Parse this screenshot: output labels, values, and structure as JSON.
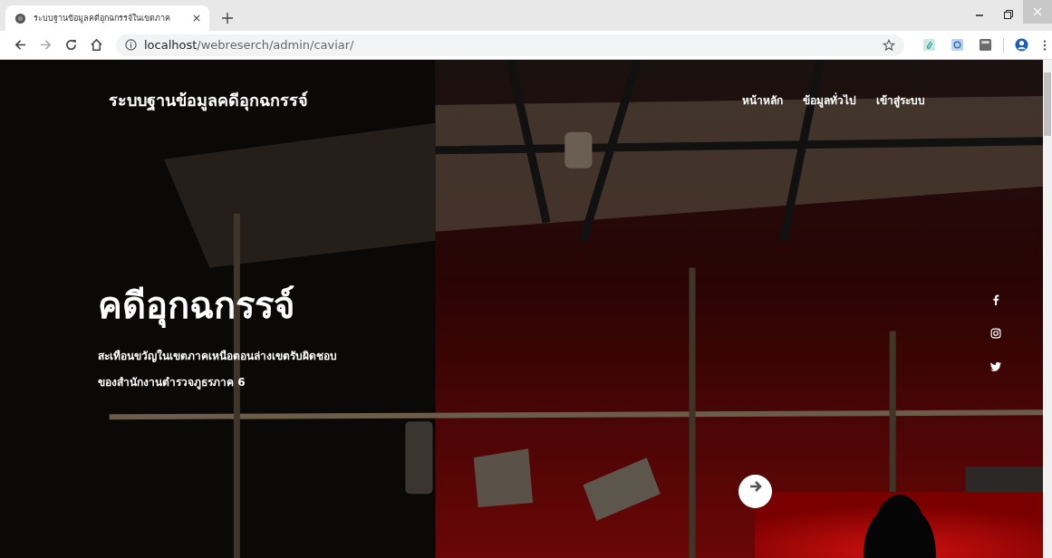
{
  "browser": {
    "tab": {
      "title": "ระบบฐานข้อมูลคดีอุกฉกรรจ์ในเขตภาค"
    },
    "url": {
      "host": "localhost",
      "path": "/webreserch/admin/caviar/"
    }
  },
  "site": {
    "brand": "ระบบฐานข้อมูลคดีอุกฉกรรจ์",
    "nav": [
      {
        "label": "หน้าหลัก"
      },
      {
        "label": "ข้อมูลทั่วไป"
      },
      {
        "label": "เข้าสู่ระบบ"
      }
    ]
  },
  "hero": {
    "title": "คดีอุกฉกรรจ์",
    "subtitle_lines": [
      "สะเทือนขวัญในเขตภาคเหนือตอนล่างเขตรับผิดชอบ",
      "ของสำนักงานตำรวจภูธรภาค 6"
    ]
  }
}
